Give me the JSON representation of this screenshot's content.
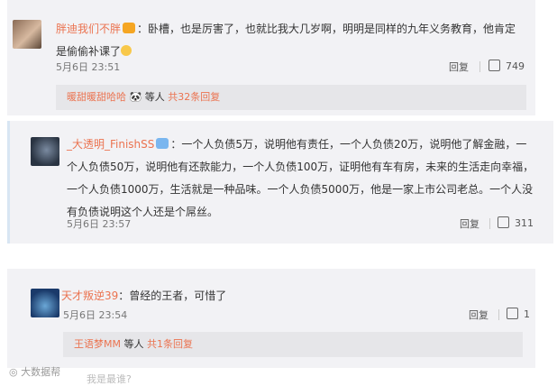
{
  "comments": [
    {
      "name": "胖迪我们不胖",
      "text": "：卧槽，也是厉害了，也就比我大几岁啊，明明是同样的九年义务教育，他肯定是偷偷补课了",
      "date": "5月6日 23:51",
      "reply": "回复",
      "likes": "749",
      "sub": {
        "name": "暖甜暖甜哈哈",
        "mid": "等人",
        "count": "共32条回复"
      }
    },
    {
      "name": "_大透明_FinishSS",
      "text": "：一个人负债5万，说明他有责任，一个人负债20万，说明他了解金融，一个人负债50万，说明他有还款能力，一个人负债100万，证明他有车有房，未来的生活走向幸福，一个人负债1000万，生活就是一种品味。一个人负债5000万，他是一家上市公司老总。一个人没有负债说明这个人还是个屌丝。",
      "date": "5月6日 23:57",
      "reply": "回复",
      "likes": "311"
    },
    {
      "name": "天才叛逆39",
      "text": "：曾经的王者，可惜了",
      "date": "5月6日 23:54",
      "reply": "回复",
      "likes": "1",
      "sub": {
        "name": "王语梦MM",
        "mid": "等人",
        "count": "共1条回复"
      }
    }
  ],
  "watermark": "大数据帮",
  "cutoff_text": "我是最谁?"
}
